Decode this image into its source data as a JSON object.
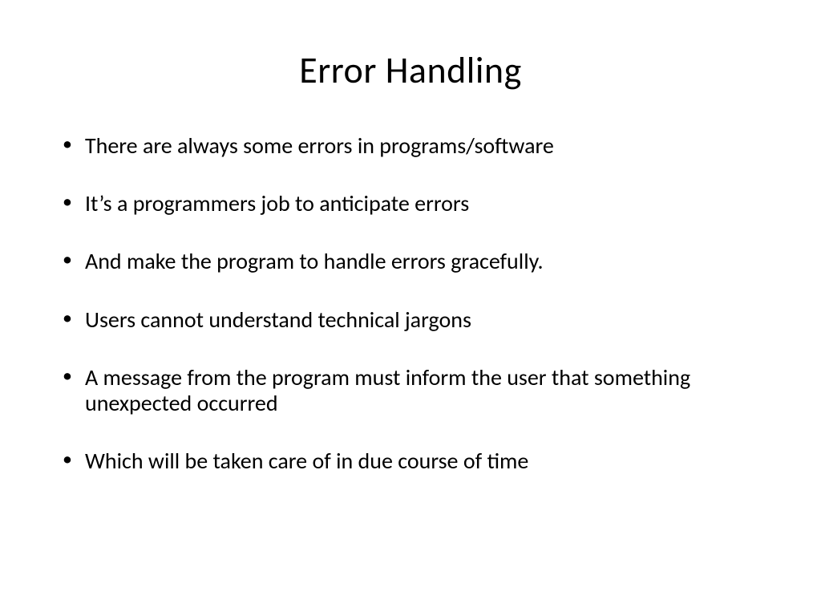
{
  "slide": {
    "title": "Error Handling",
    "bullets": [
      "There are always some errors in programs/software",
      "It’s a programmers job to anticipate errors",
      "And make the program to handle errors gracefully.",
      "Users cannot understand technical jargons",
      "A message from the program must inform the user that something unexpected occurred",
      "Which will be taken care of in due course of time"
    ]
  }
}
